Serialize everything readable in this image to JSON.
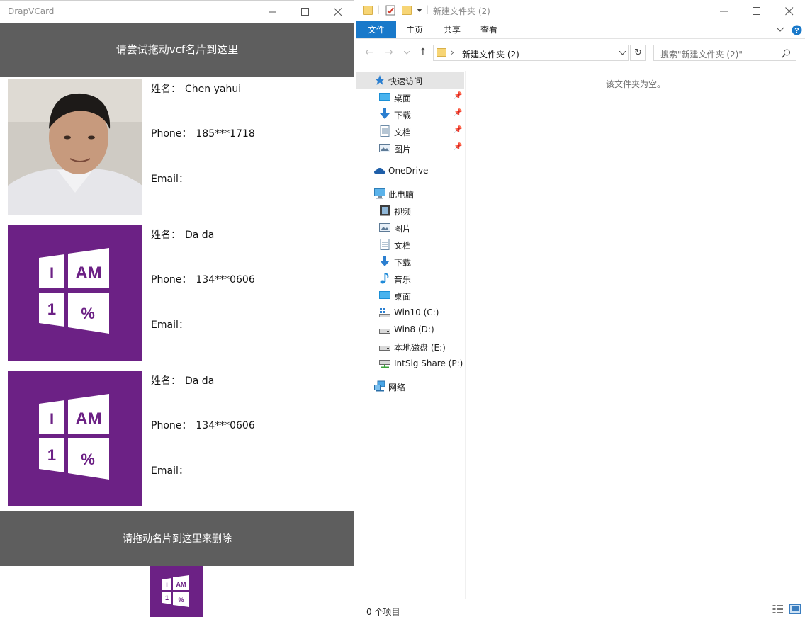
{
  "app": {
    "title": "DrapVCard",
    "drop_hint": "请尝试拖动vcf名片到这里",
    "delete_hint": "请拖动名片到这里来删除",
    "tile_glyphs": [
      "I",
      "AM",
      "1",
      "%"
    ],
    "cards": [
      {
        "name_label": "姓名：",
        "name": "Chen yahui",
        "phone_label": "Phone：",
        "phone": "185***1718",
        "email_label": "Email：",
        "email": "",
        "photo": "person-photo"
      },
      {
        "name_label": "姓名：",
        "name": "Da da",
        "phone_label": "Phone：",
        "phone": "134***0606",
        "email_label": "Email：",
        "email": "",
        "photo": "windows-tile"
      },
      {
        "name_label": "姓名：",
        "name": "Da da",
        "phone_label": "Phone：",
        "phone": "134***0606",
        "email_label": "Email：",
        "email": "",
        "photo": "windows-tile"
      }
    ],
    "tile_color": "#6c2185",
    "bar_color": "#5e5e5e"
  },
  "explorer": {
    "title": "新建文件夹 (2)",
    "tabs": [
      "文件",
      "主页",
      "共享",
      "查看"
    ],
    "address": "新建文件夹 (2)",
    "search_placeholder": "搜索\"新建文件夹 (2)\"",
    "nav": [
      {
        "label": "快速访问",
        "icon": "star-icon",
        "selected": true,
        "pinned": false
      },
      {
        "label": "桌面",
        "icon": "desktop-icon",
        "pinned": true
      },
      {
        "label": "下载",
        "icon": "download-icon",
        "pinned": true
      },
      {
        "label": "文档",
        "icon": "document-icon",
        "pinned": true
      },
      {
        "label": "图片",
        "icon": "pictures-icon",
        "pinned": true
      },
      {
        "label": "OneDrive",
        "icon": "cloud-icon"
      },
      {
        "label": "此电脑",
        "icon": "computer-icon"
      },
      {
        "label": "视频",
        "icon": "video-icon"
      },
      {
        "label": "图片",
        "icon": "pictures-icon"
      },
      {
        "label": "文档",
        "icon": "document-icon"
      },
      {
        "label": "下载",
        "icon": "download-icon"
      },
      {
        "label": "音乐",
        "icon": "music-icon"
      },
      {
        "label": "桌面",
        "icon": "desktop-icon"
      },
      {
        "label": "Win10 (C:)",
        "icon": "windows-drive-icon"
      },
      {
        "label": "Win8 (D:)",
        "icon": "drive-icon"
      },
      {
        "label": "本地磁盘 (E:)",
        "icon": "drive-icon"
      },
      {
        "label": "IntSig Share (P:)",
        "icon": "network-drive-icon"
      },
      {
        "label": "网络",
        "icon": "network-icon"
      }
    ],
    "empty_message": "该文件夹为空。",
    "status": "0 个项目",
    "accent_color": "#1979ca"
  }
}
